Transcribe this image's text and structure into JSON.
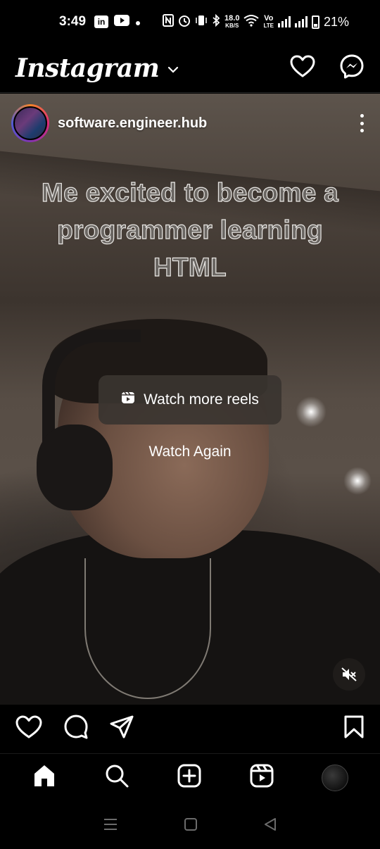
{
  "status_bar": {
    "time": "3:49",
    "net_speed": "18.0",
    "net_unit": "KB/S",
    "volte_top": "Vo",
    "volte_bottom": "LTE",
    "battery": "21%",
    "icons": [
      "linkedin-icon",
      "youtube-icon",
      "dot-icon",
      "nfc-icon",
      "alarm-icon",
      "vibrate-icon",
      "bluetooth-icon",
      "wifi-icon",
      "signal-icon",
      "battery-icon"
    ]
  },
  "header": {
    "logo": "Instagram",
    "icons": [
      "chevron-down-icon",
      "heart-icon",
      "messenger-icon"
    ]
  },
  "post": {
    "username": "software.engineer.hub",
    "caption_lines": [
      "Me excited to become a",
      "programmer learning",
      "HTML"
    ],
    "watch_more_label": "Watch more reels",
    "watch_again_label": "Watch Again",
    "icons": [
      "more-options-icon",
      "reels-icon",
      "mute-icon"
    ]
  },
  "actions": {
    "icons": [
      "like-icon",
      "comment-icon",
      "share-icon",
      "save-icon"
    ]
  },
  "bottom_nav": {
    "items": [
      "home",
      "search",
      "create",
      "reels",
      "profile"
    ],
    "active": "home"
  },
  "system_nav": {
    "items": [
      "recents",
      "home",
      "back"
    ]
  }
}
